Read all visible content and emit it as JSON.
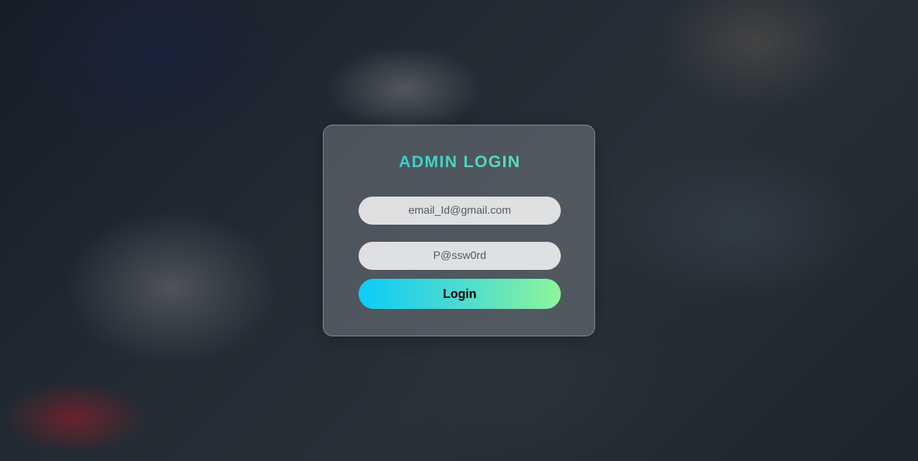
{
  "login": {
    "title": "ADMIN LOGIN",
    "email_placeholder": "email_Id@gmail.com",
    "password_placeholder": "P@ssw0rd",
    "button_label": "Login"
  },
  "colors": {
    "title_gradient_start": "#1ec8e0",
    "title_gradient_end": "#6fe8a8",
    "button_gradient_start": "#0bcdf8",
    "button_gradient_end": "#8cf69a"
  }
}
